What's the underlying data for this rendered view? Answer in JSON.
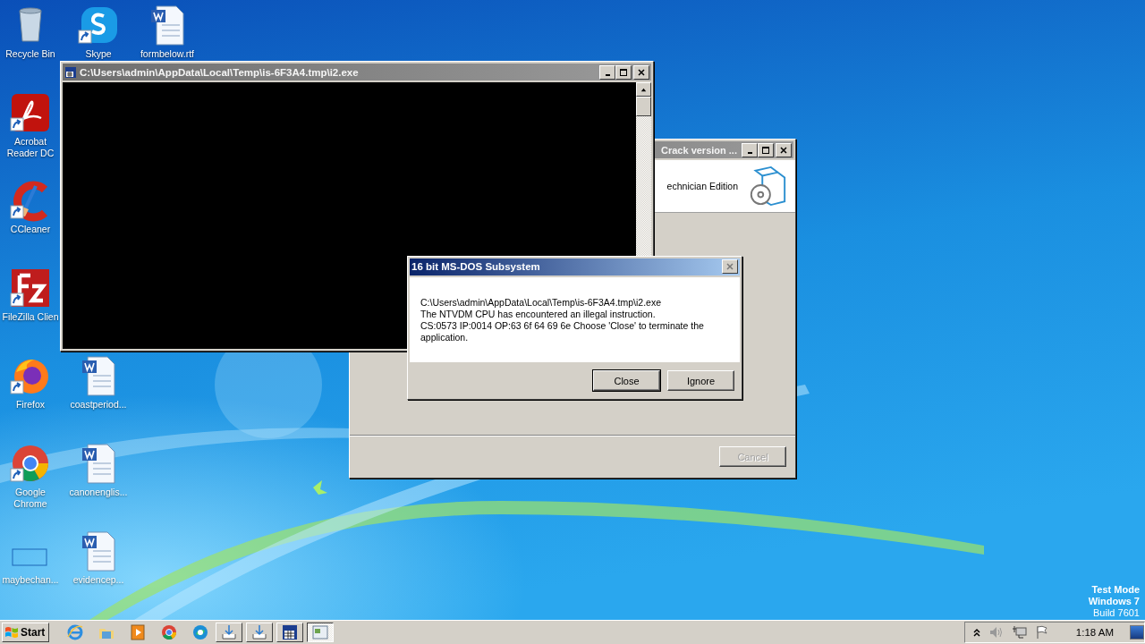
{
  "desktop_icons": [
    {
      "label": "Recycle Bin",
      "kind": "recycle-bin"
    },
    {
      "label": "Skype",
      "kind": "skype"
    },
    {
      "label": "formbelow.rtf",
      "kind": "word"
    },
    {
      "label": "Acrobat Reader DC",
      "kind": "acrobat"
    },
    {
      "label": "CCleaner",
      "kind": "ccleaner"
    },
    {
      "label": "FileZilla Clien",
      "kind": "filezilla"
    },
    {
      "label": "Firefox",
      "kind": "firefox"
    },
    {
      "label": "coastperiod...",
      "kind": "word"
    },
    {
      "label": "Google Chrome",
      "kind": "chrome"
    },
    {
      "label": "canonenglis...",
      "kind": "word"
    },
    {
      "label": "maybechan...",
      "kind": "blank"
    },
    {
      "label": "evidencep...",
      "kind": "word"
    }
  ],
  "background_window": {
    "title": "Crack version ...",
    "active": false,
    "header_text": "echnician Edition",
    "buttons": [
      {
        "label": "Cancel",
        "disabled": true
      }
    ]
  },
  "console_window": {
    "title": "C:\\Users\\admin\\AppData\\Local\\Temp\\is-6F3A4.tmp\\i2.exe",
    "active": false
  },
  "dialog": {
    "title": "16 bit MS-DOS Subsystem",
    "active": true,
    "message": [
      "C:\\Users\\admin\\AppData\\Local\\Temp\\is-6F3A4.tmp\\i2.exe",
      "The NTVDM CPU has encountered an illegal instruction.",
      "CS:0573 IP:0014 OP:63 6f 64 69 6e Choose 'Close' to terminate the application."
    ],
    "buttons": [
      {
        "label": "Close",
        "default": true
      },
      {
        "label": "Ignore",
        "default": false
      }
    ]
  },
  "system_text": [
    "Test Mode",
    "Windows 7",
    "Build 7601"
  ],
  "taskbar": {
    "start": "Start",
    "items": [
      {
        "kind": "ie",
        "selected": false
      },
      {
        "kind": "folder",
        "selected": false
      },
      {
        "kind": "media",
        "selected": false
      },
      {
        "kind": "chrome",
        "selected": false
      },
      {
        "kind": "edge",
        "selected": false
      },
      {
        "kind": "download",
        "selected": false
      },
      {
        "kind": "download",
        "selected": false
      },
      {
        "kind": "dos",
        "selected": false
      },
      {
        "kind": "window",
        "selected": true
      }
    ],
    "clock": "1:18 AM"
  }
}
